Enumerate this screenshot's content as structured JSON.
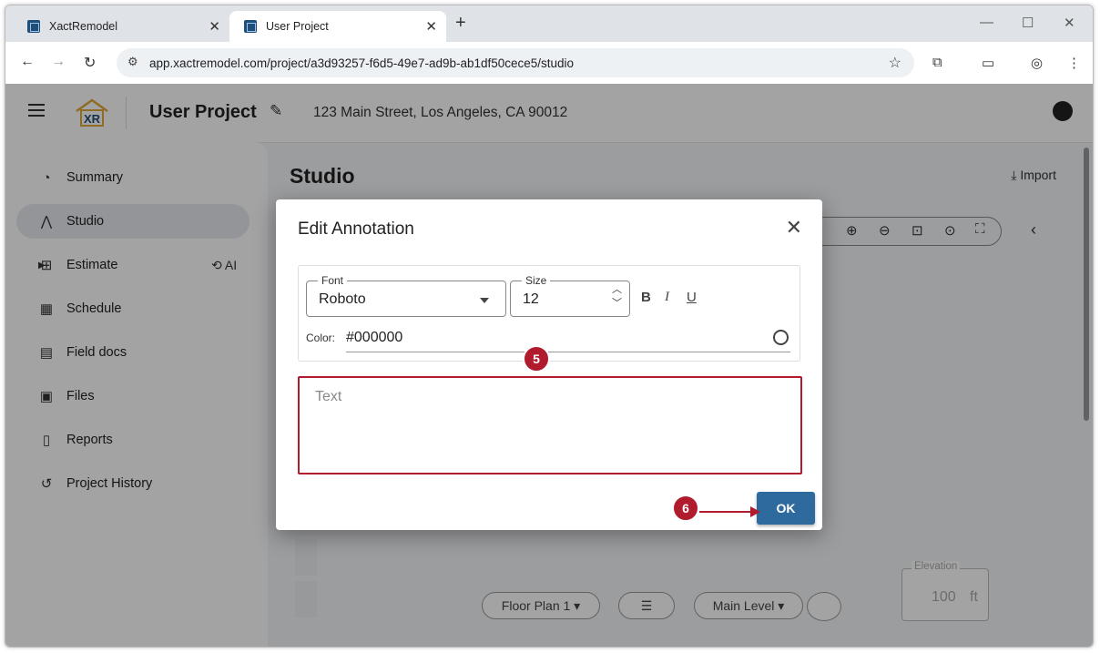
{
  "browser": {
    "tabs": [
      {
        "label": "XactRemodel"
      },
      {
        "label": "User Project"
      }
    ],
    "url": "app.xactremodel.com/project/a3d93257-f6d5-49e7-ad9b-ab1df50cece5/studio"
  },
  "appbar": {
    "logo_text": "XR",
    "project_title": "User Project",
    "address": "123 Main Street, Los Angeles, CA 90012"
  },
  "sidebar": {
    "items": [
      {
        "label": "Summary",
        "icon": "speedometer-icon"
      },
      {
        "label": "Studio",
        "icon": "compass-icon",
        "active": true
      },
      {
        "label": "Estimate",
        "icon": "calculator-icon",
        "extra": "AI"
      },
      {
        "label": "Schedule",
        "icon": "calendar-icon"
      },
      {
        "label": "Field docs",
        "icon": "field-docs-icon"
      },
      {
        "label": "Files",
        "icon": "photo-library-icon"
      },
      {
        "label": "Reports",
        "icon": "document-icon"
      },
      {
        "label": "Project History",
        "icon": "history-icon"
      }
    ]
  },
  "main": {
    "title": "Studio",
    "import_label": "Import",
    "floor_plan_label": "Floor Plan 1",
    "level_label": "Main Level",
    "elevation": {
      "label": "Elevation",
      "value": "100",
      "unit": "ft"
    }
  },
  "dialog": {
    "title": "Edit Annotation",
    "font": {
      "label": "Font",
      "value": "Roboto"
    },
    "size": {
      "label": "Size",
      "value": "12"
    },
    "format_buttons": [
      "B",
      "I",
      "U"
    ],
    "color": {
      "label": "Color:",
      "value": "#000000"
    },
    "text_placeholder": "Text",
    "ok_label": "OK"
  },
  "callouts": [
    {
      "number": "5"
    },
    {
      "number": "6"
    }
  ],
  "colors": {
    "accent": "#2f6a9e",
    "callout": "#b01c2e"
  }
}
